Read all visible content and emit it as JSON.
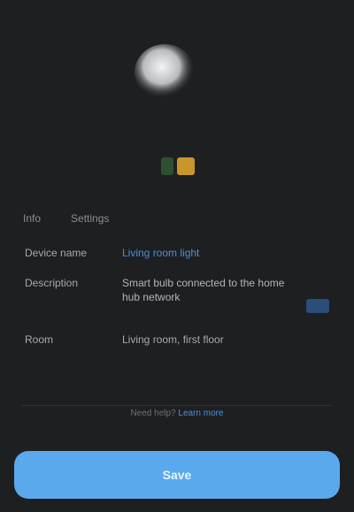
{
  "device": {
    "image_icon": "light-bulb-icon",
    "status": {
      "online_color": "#3a7a3e",
      "warning_color": "#c9962c"
    }
  },
  "tabs": [
    {
      "label": "Info"
    },
    {
      "label": "Settings"
    }
  ],
  "details": {
    "name_label": "Device name",
    "name_value": "Living room light",
    "description_label": "Description",
    "description_value": "Smart bulb connected to the home hub network",
    "location_label": "Room",
    "location_value": "Living room, first floor"
  },
  "helper": {
    "text": "Need help?",
    "link": "Learn more"
  },
  "cta": {
    "label": "Save"
  },
  "colors": {
    "background": "#1e1f21",
    "accent": "#5aa9ec",
    "link": "#4e8fd6"
  }
}
